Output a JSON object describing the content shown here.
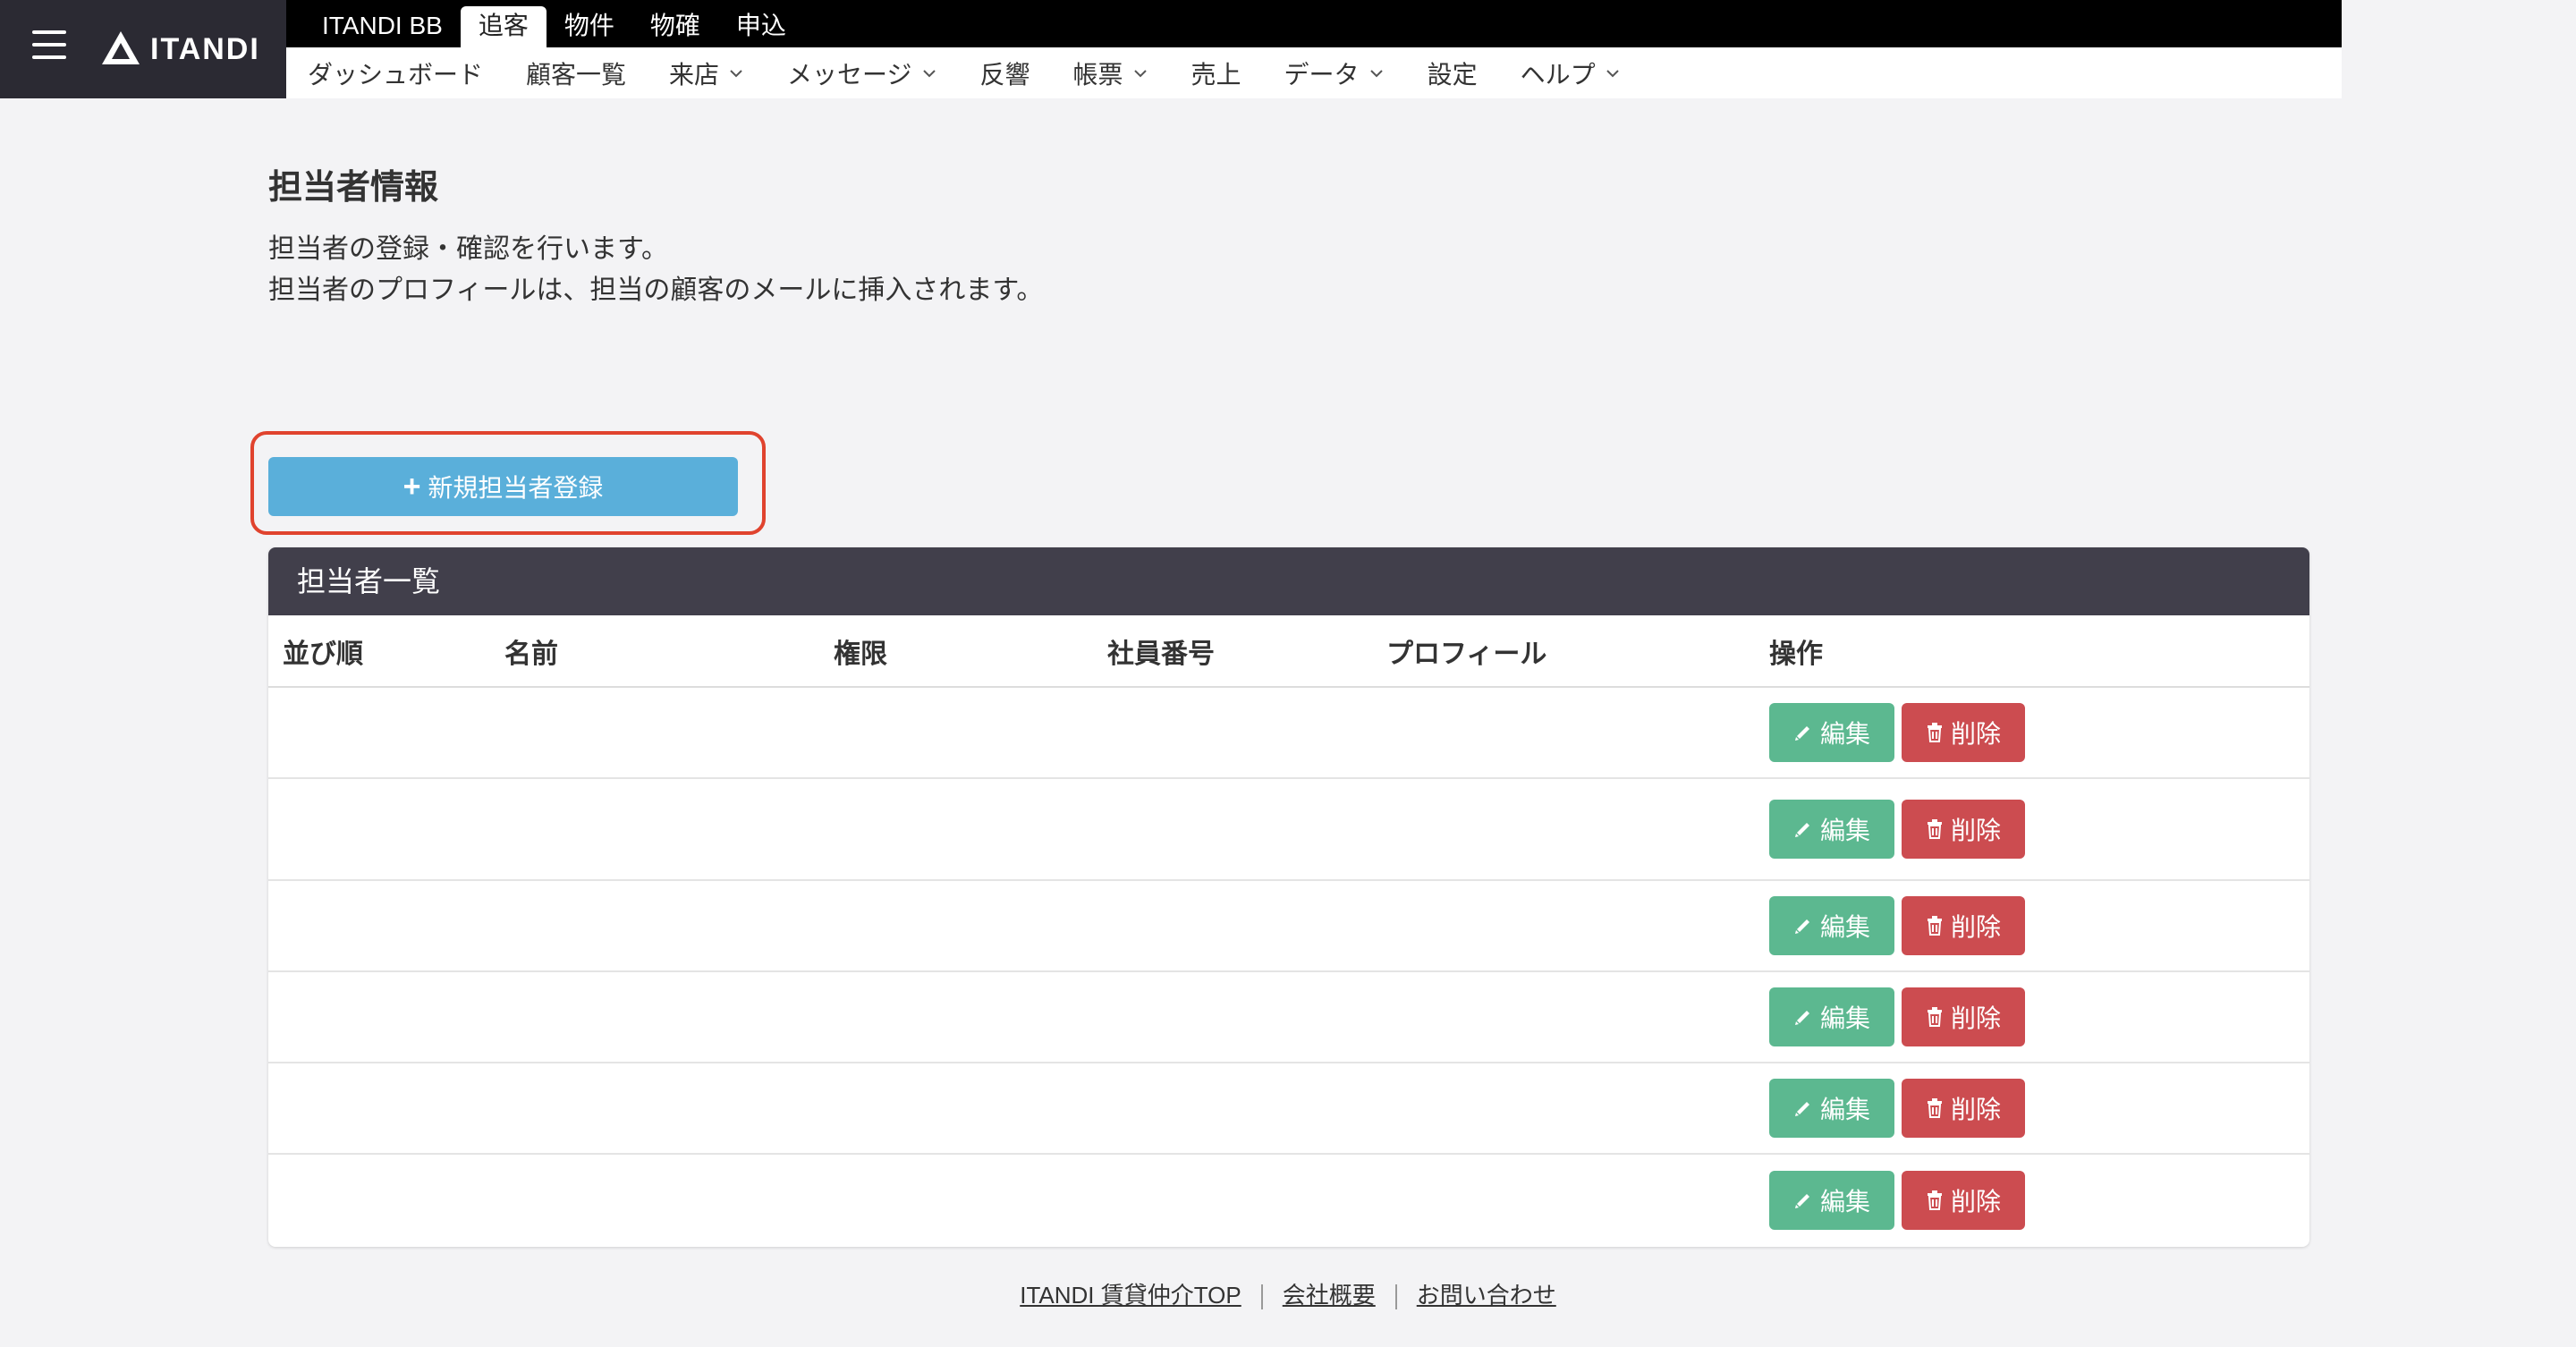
{
  "header": {
    "logo_text": "ITANDI",
    "product_tabs": [
      {
        "label": "ITANDI BB",
        "active": false
      },
      {
        "label": "追客",
        "active": true
      },
      {
        "label": "物件",
        "active": false
      },
      {
        "label": "物確",
        "active": false
      },
      {
        "label": "申込",
        "active": false
      }
    ],
    "subnav": [
      {
        "label": "ダッシュボード",
        "dropdown": false
      },
      {
        "label": "顧客一覧",
        "dropdown": false
      },
      {
        "label": "来店",
        "dropdown": true
      },
      {
        "label": "メッセージ",
        "dropdown": true
      },
      {
        "label": "反響",
        "dropdown": false
      },
      {
        "label": "帳票",
        "dropdown": true
      },
      {
        "label": "売上",
        "dropdown": false
      },
      {
        "label": "データ",
        "dropdown": true
      },
      {
        "label": "設定",
        "dropdown": false
      },
      {
        "label": "ヘルプ",
        "dropdown": true
      }
    ]
  },
  "page": {
    "title": "担当者情報",
    "desc_line1": "担当者の登録・確認を行います。",
    "desc_line2": "担当者のプロフィールは、担当の顧客のメールに挿入されます。",
    "new_button_label": "新規担当者登録"
  },
  "panel": {
    "title": "担当者一覧",
    "columns": [
      "並び順",
      "名前",
      "権限",
      "社員番号",
      "プロフィール",
      "操作"
    ],
    "edit_label": "編集",
    "delete_label": "削除",
    "rows": [
      {
        "order": "",
        "name": "",
        "role": "",
        "employee_no": "",
        "profile": ""
      },
      {
        "order": "",
        "name": "",
        "role": "",
        "employee_no": "",
        "profile": ""
      },
      {
        "order": "",
        "name": "",
        "role": "",
        "employee_no": "",
        "profile": ""
      },
      {
        "order": "",
        "name": "",
        "role": "",
        "employee_no": "",
        "profile": ""
      },
      {
        "order": "",
        "name": "",
        "role": "",
        "employee_no": "",
        "profile": ""
      },
      {
        "order": "",
        "name": "",
        "role": "",
        "employee_no": "",
        "profile": ""
      }
    ]
  },
  "footer": {
    "links": [
      "ITANDI 賃貸仲介TOP",
      "会社概要",
      "お問い合わせ"
    ]
  },
  "colors": {
    "header_bg": "#2b2a33",
    "primary_button": "#5aafda",
    "edit_button": "#5cb890",
    "delete_button": "#cc4c50",
    "highlight": "#e0432e"
  }
}
